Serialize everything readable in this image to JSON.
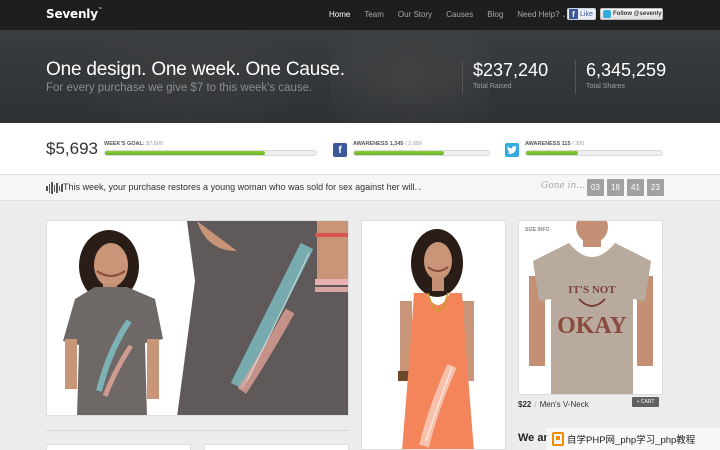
{
  "nav": {
    "logo": "Sevenly",
    "logo_mark": "™",
    "items": [
      {
        "label": "Home",
        "active": true
      },
      {
        "label": "Team"
      },
      {
        "label": "Our Story"
      },
      {
        "label": "Causes"
      },
      {
        "label": "Blog"
      },
      {
        "label": "Need Help?"
      }
    ],
    "help_chevron": "⌄",
    "fb_like": "Like",
    "fb_glyph": "f",
    "tw_follow": "Follow @sevenly"
  },
  "hero": {
    "headline": "One design. One week. One Cause.",
    "subhead": "For every purchase we give $7 to this week's cause.",
    "stats": [
      {
        "value": "$237,240",
        "label": "Total Raised"
      },
      {
        "value": "6,345,259",
        "label": "Total Shares"
      }
    ]
  },
  "goals": {
    "current_amount": "$5,693",
    "weekly_goal": {
      "label": "WEEK'S GOAL:",
      "value": "$7,500",
      "progress": 0.76
    },
    "facebook": {
      "label": "AWARENESS 1,345",
      "value": "/ 2,000",
      "progress": 0.67
    },
    "twitter": {
      "label": "AWARENESS 115",
      "value": "/ 300",
      "progress": 0.38
    },
    "tw_glyph": "t"
  },
  "cause": {
    "text": "This week, your purchase restores a young woman who was sold for sex against her will.",
    "chevron": "⌄",
    "gone_in_label": "Gone in...",
    "timer": [
      "03",
      "18",
      "41",
      "23"
    ]
  },
  "products": {
    "size_info": "SIZE INFO",
    "shirt_print_top": "IT'S NOT",
    "shirt_print_mid": "OKAY",
    "price": "$22",
    "name": "Men's V-Neck",
    "cart": "+ CART",
    "promo_heading": "We ar"
  },
  "watermark": {
    "text": "自学PHP网_php学习_php教程"
  },
  "colors": {
    "progress_green": "#6cb523",
    "facebook_blue": "#3b5998",
    "twitter_blue": "#33aae0",
    "orange_tank": "#f4845a",
    "heather_gray_tee": "#6e6866"
  },
  "icons": [
    "sound-wave-icon",
    "facebook-icon",
    "twitter-icon",
    "chevron-down-icon",
    "cart-icon"
  ]
}
